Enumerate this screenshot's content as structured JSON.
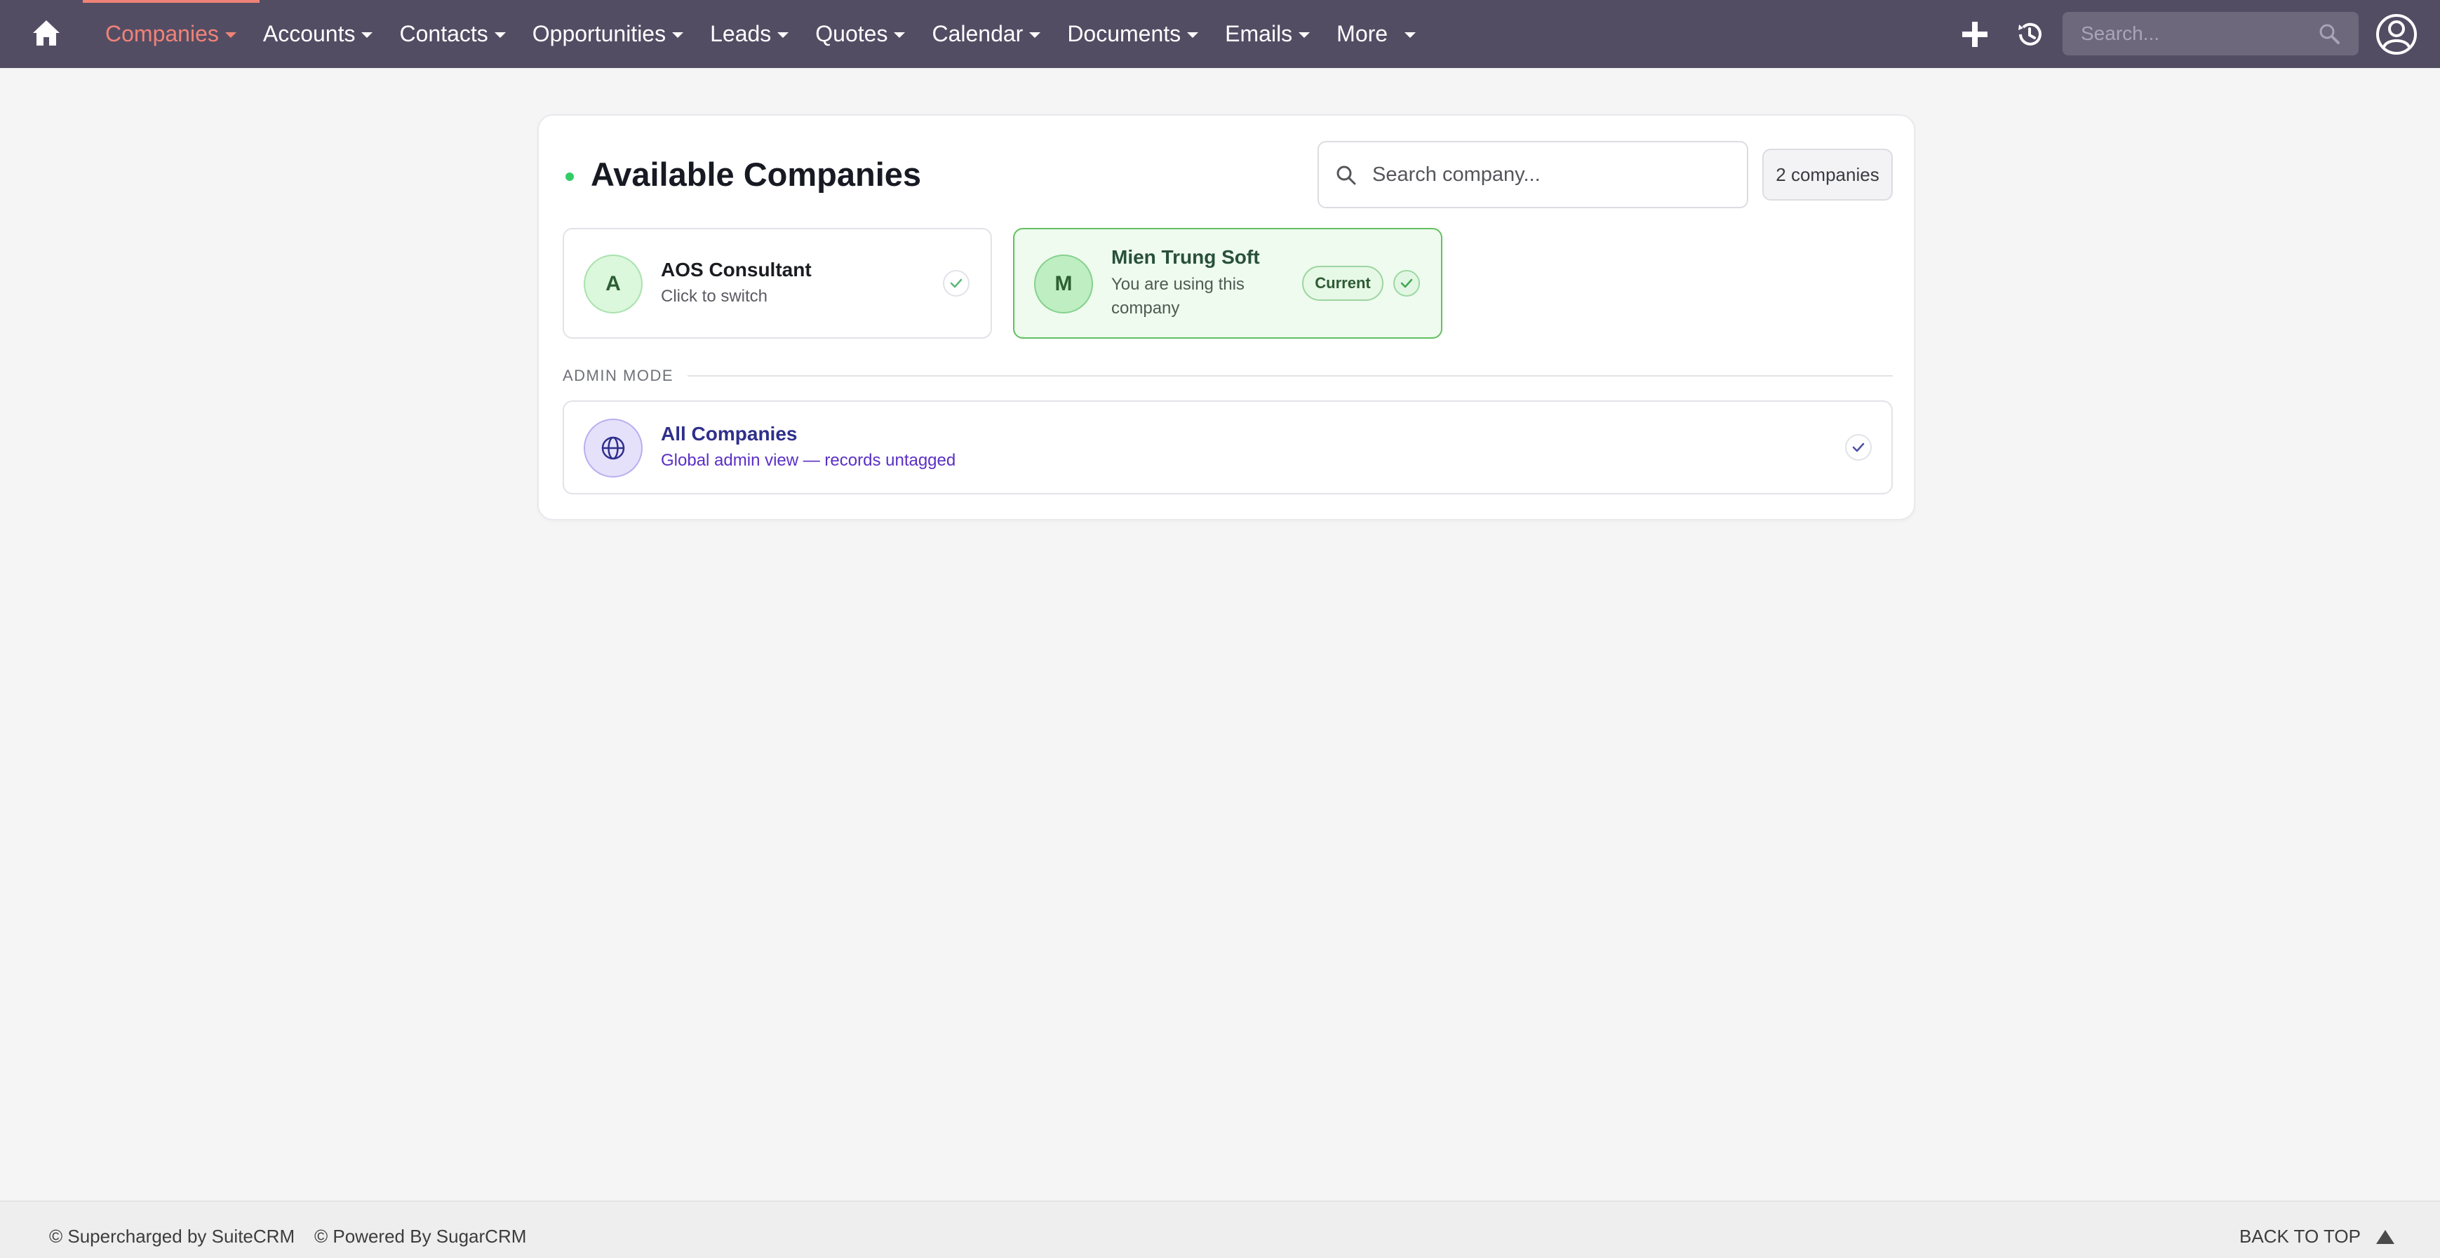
{
  "nav": {
    "items": [
      {
        "label": "Companies",
        "active": true
      },
      {
        "label": "Accounts"
      },
      {
        "label": "Contacts"
      },
      {
        "label": "Opportunities"
      },
      {
        "label": "Leads"
      },
      {
        "label": "Quotes"
      },
      {
        "label": "Calendar"
      },
      {
        "label": "Documents"
      },
      {
        "label": "Emails"
      },
      {
        "label": "More"
      }
    ],
    "search_placeholder": "Search...",
    "icons": [
      "home-icon",
      "plus-icon",
      "history-icon",
      "search-icon",
      "user-avatar-icon"
    ],
    "colors": {
      "bar": "#534d64",
      "active": "#f08377"
    }
  },
  "companies_panel": {
    "title": "Available Companies",
    "search_placeholder": "Search company...",
    "count_badge": "2 companies",
    "companies": [
      {
        "initial": "A",
        "name": "AOS Consultant",
        "subtitle": "Click to switch",
        "current": false
      },
      {
        "initial": "M",
        "name": "Mien Trung Soft",
        "subtitle": "You are using this company",
        "current": true,
        "badge": "Current"
      }
    ],
    "admin_section_label": "ADMIN MODE",
    "admin_option": {
      "title": "All Companies",
      "subtitle": "Global admin view — records untagged"
    },
    "colors": {
      "current_border": "#62c060",
      "current_bg": "#eefbee",
      "admin_title": "#2e2f8c",
      "admin_sub": "#5a2fc6"
    }
  },
  "footer": {
    "supercharged": "© Supercharged by SuiteCRM",
    "powered": "© Powered By SugarCRM",
    "back_to_top": "BACK TO TOP"
  }
}
